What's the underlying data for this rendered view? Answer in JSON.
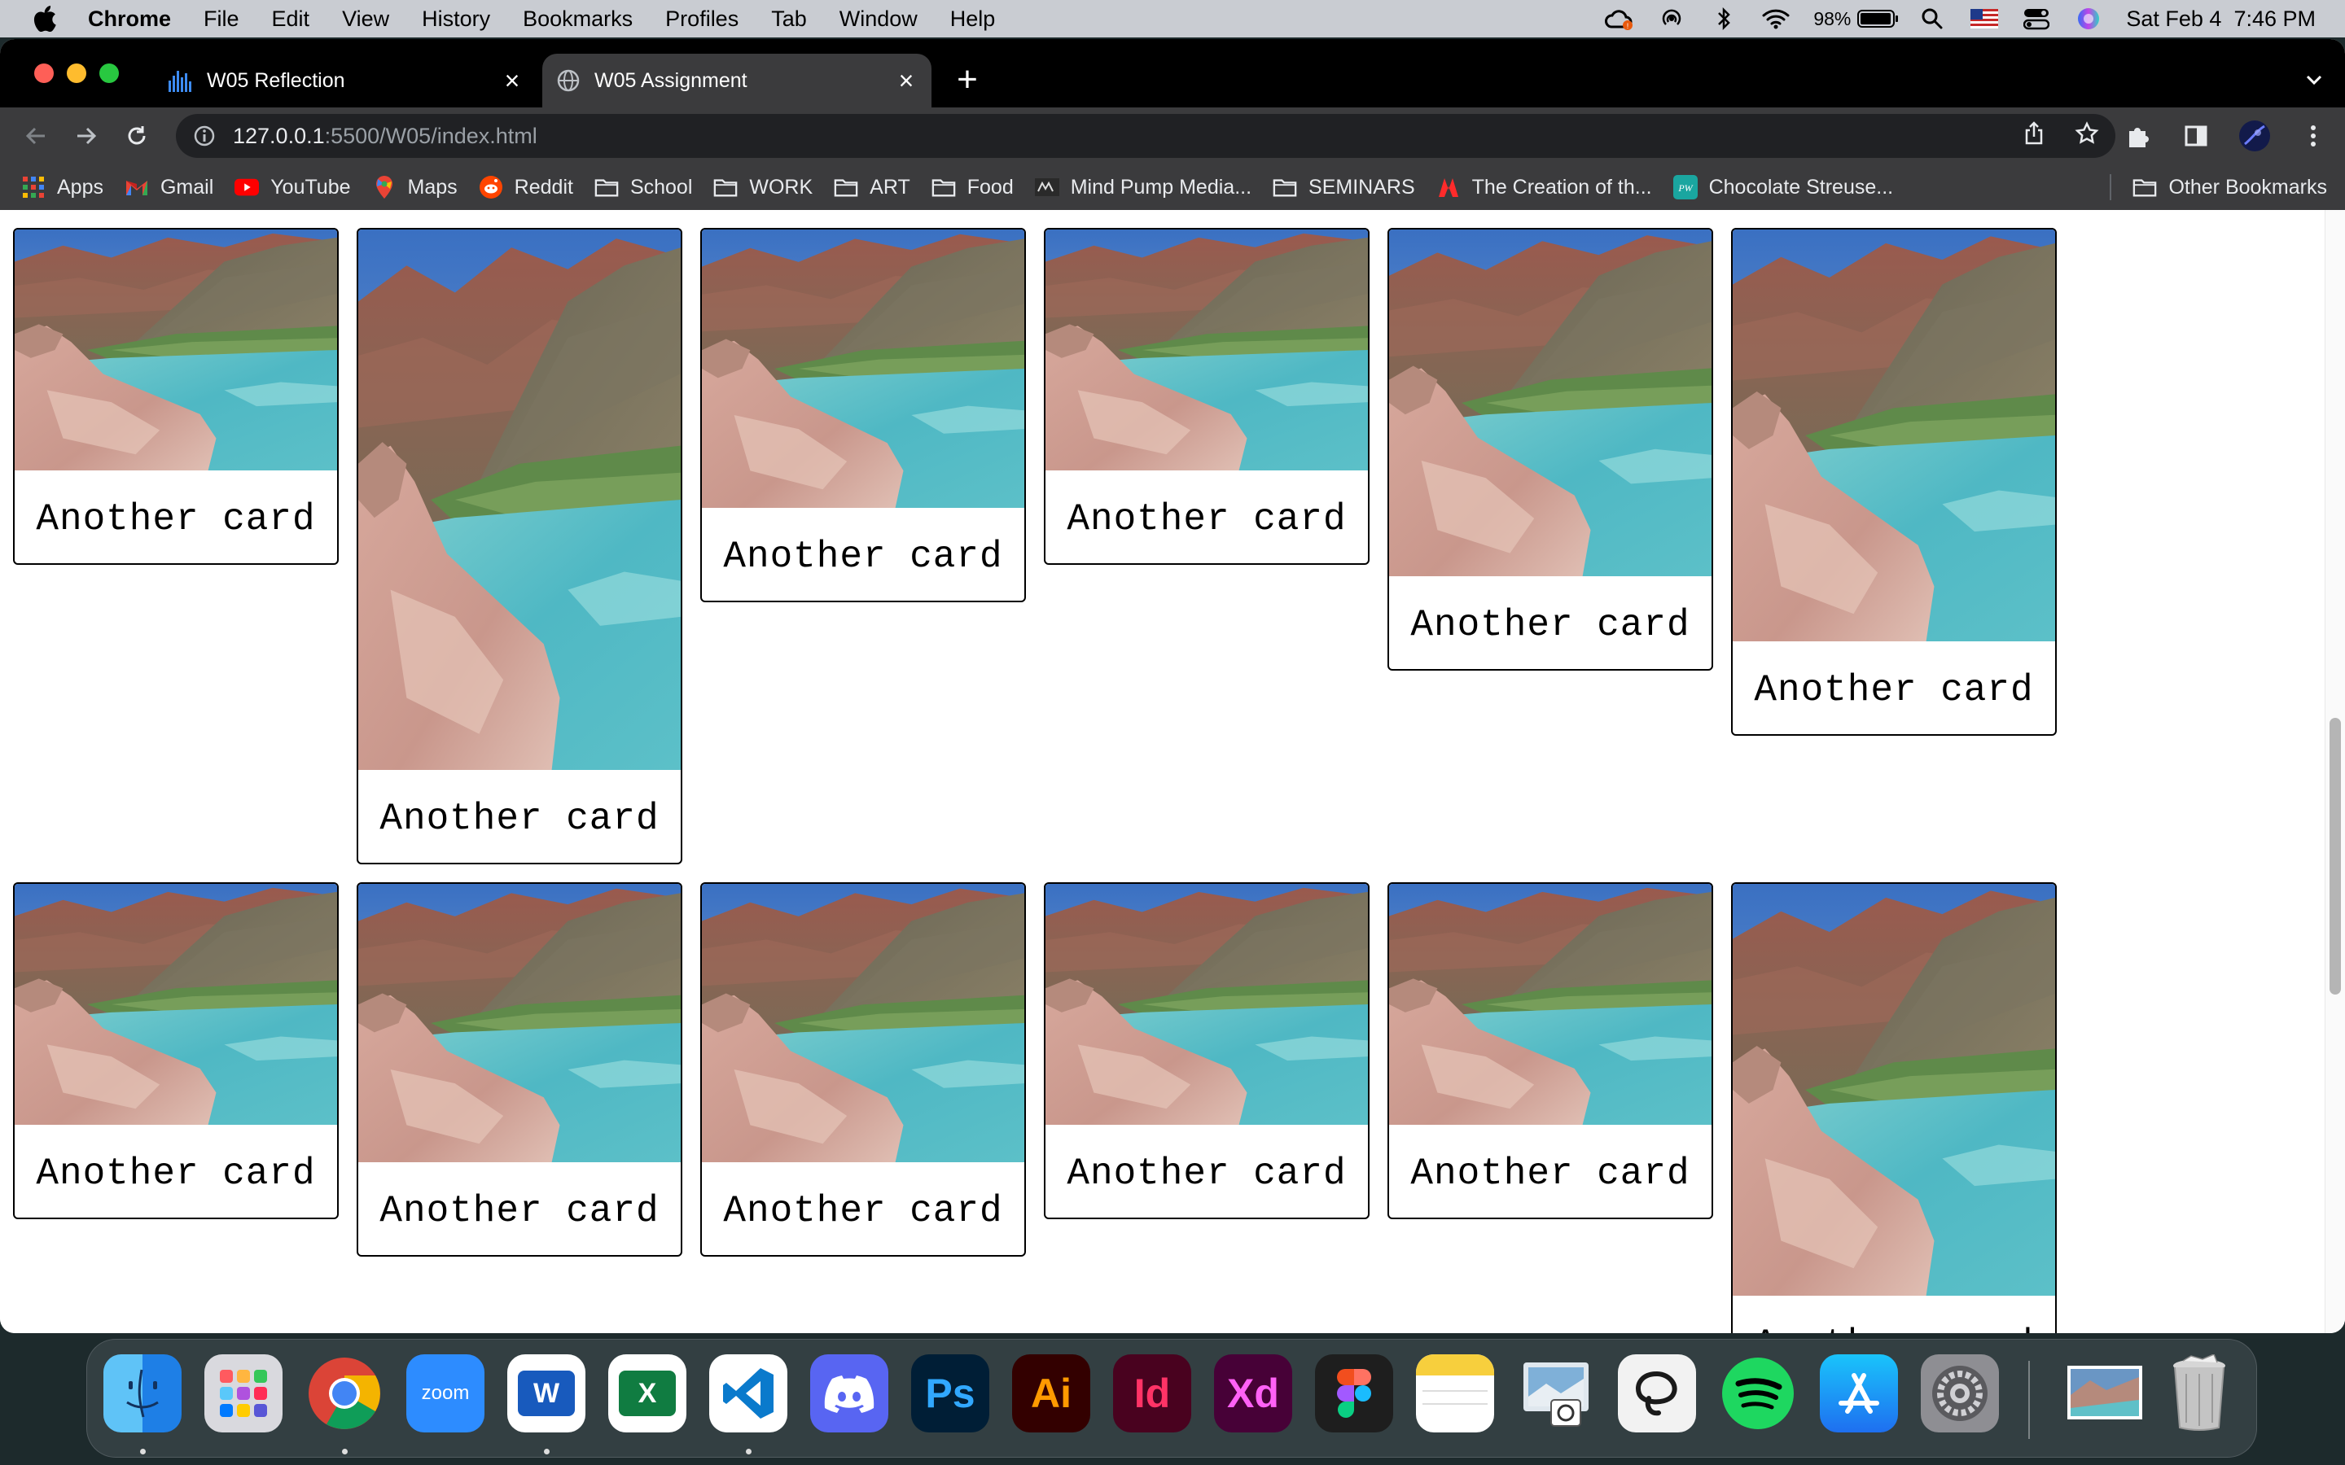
{
  "menubar": {
    "app": "Chrome",
    "items": [
      "File",
      "Edit",
      "View",
      "History",
      "Bookmarks",
      "Profiles",
      "Tab",
      "Window",
      "Help"
    ],
    "battery": "98%",
    "battery_level": 0.98,
    "datetime": "Sat Feb 4  7:46 PM"
  },
  "tabs": [
    {
      "title": "W05 Reflection",
      "active": false
    },
    {
      "title": "W05 Assignment",
      "active": true
    }
  ],
  "address": {
    "host": "127.0.0.1",
    "path": ":5500/W05/index.html"
  },
  "bookmarks": [
    "Apps",
    "Gmail",
    "YouTube",
    "Maps",
    "Reddit",
    "School",
    "WORK",
    "ART",
    "Food",
    "Mind Pump Media...",
    "SEMINARS",
    "The Creation of th...",
    "Chocolate Streuse..."
  ],
  "other_bookmarks": "Other Bookmarks",
  "cards": {
    "row1": [
      "Another card",
      "Another card",
      "Another card",
      "Another card",
      "Another card",
      "Another card"
    ],
    "row2": [
      "Another card",
      "Another card",
      "Another card",
      "Another card",
      "Another card",
      "Another card"
    ]
  },
  "dock": {
    "apps": [
      "Finder",
      "Launchpad",
      "Google Chrome",
      "zoom",
      "Microsoft Word",
      "Microsoft Excel",
      "Visual Studio Code",
      "Discord",
      "Ps",
      "Ai",
      "Id",
      "Xd",
      "Figma",
      "Notes",
      "Preview",
      "Notion-like",
      "Spotify",
      "App Store",
      "System Preferences"
    ],
    "zoom_label": "zoom",
    "ps": "Ps",
    "ai": "Ai",
    "id": "Id",
    "xd": "Xd",
    "word": "W",
    "excel": "X"
  },
  "colors": {
    "accent_blue": "#1a73e8",
    "tab_bg": "#3b3b3d"
  }
}
